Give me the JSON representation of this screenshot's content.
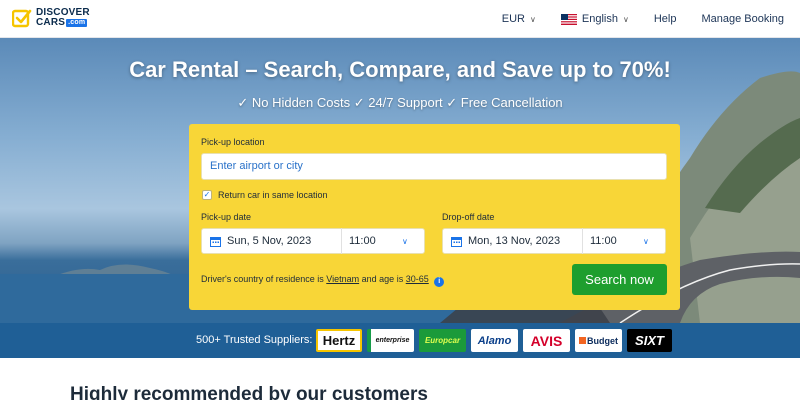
{
  "header": {
    "logo_line1": "DISCOVER",
    "logo_line2": "CARS",
    "logo_suffix": ".com",
    "nav": {
      "currency": "EUR",
      "language": "English",
      "help": "Help",
      "manage_booking": "Manage Booking"
    }
  },
  "hero": {
    "title": "Car Rental – Search, Compare, and Save up to 70%!",
    "subtitle": "✓ No Hidden Costs ✓ 24/7 Support ✓ Free Cancellation"
  },
  "search": {
    "pickup_location_label": "Pick-up location",
    "pickup_location_placeholder": "Enter airport or city",
    "return_same_label": "Return car in same location",
    "return_same_checked": true,
    "pickup_date_label": "Pick-up date",
    "pickup_date": "Sun, 5 Nov, 2023",
    "pickup_time": "11:00",
    "dropoff_date_label": "Drop-off date",
    "dropoff_date": "Mon, 13 Nov, 2023",
    "dropoff_time": "11:00",
    "residence_prefix": "Driver's country of residence is",
    "residence_country": "Vietnam",
    "residence_mid": "and age is",
    "residence_age": "30-65",
    "search_button": "Search now"
  },
  "suppliers": {
    "label": "500+ Trusted Suppliers:",
    "brands": [
      "Hertz",
      "enterprise",
      "Europcar",
      "Alamo",
      "AVIS",
      "Budget",
      "SIXT"
    ]
  },
  "section_title": "Highly recommended by our customers",
  "colors": {
    "panel": "#f8d637",
    "search_button": "#1e9e2e",
    "suppliers_band": "#1f5f96",
    "link": "#1a73e8"
  }
}
